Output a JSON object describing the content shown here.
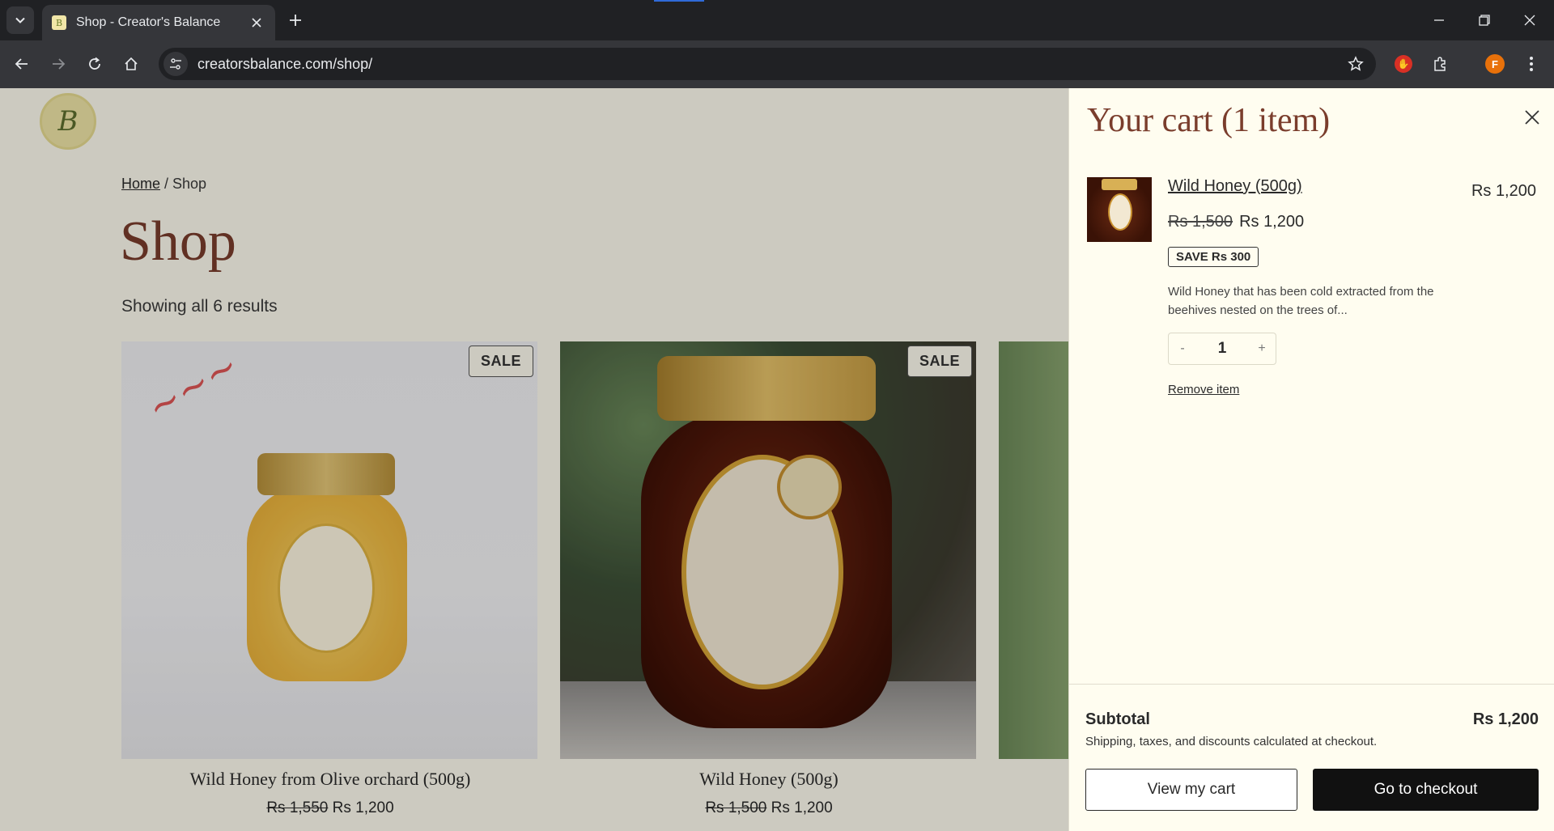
{
  "browser": {
    "tab_title": "Shop - Creator's Balance",
    "url": "creatorsbalance.com/shop/",
    "profile_initial": "F"
  },
  "site": {
    "logo_text": "B"
  },
  "shop": {
    "breadcrumb_home": "Home",
    "breadcrumb_sep": " / ",
    "breadcrumb_current": "Shop",
    "title": "Shop",
    "result_count": "Showing all 6 results",
    "products": [
      {
        "badge": "SALE",
        "name": "Wild Honey from Olive orchard (500g)",
        "old_price": "Rs 1,550",
        "price": "Rs 1,200"
      },
      {
        "badge": "SALE",
        "name": "Wild Honey (500g)",
        "old_price": "Rs 1,500",
        "price": "Rs 1,200"
      }
    ]
  },
  "cart": {
    "title": "Your cart (1 item)",
    "item": {
      "name": "Wild Honey (500g)",
      "line_total": "Rs 1,200",
      "old_price": "Rs 1,500",
      "price": "Rs 1,200",
      "save_badge": "SAVE Rs 300",
      "description": "Wild Honey that has been cold extracted from the beehives nested on the trees of...",
      "qty_minus": "-",
      "quantity": "1",
      "qty_plus": "+",
      "remove_label": "Remove item"
    },
    "subtotal_label": "Subtotal",
    "subtotal_value": "Rs 1,200",
    "subtotal_note": "Shipping, taxes, and discounts calculated at checkout.",
    "view_cart_label": "View my cart",
    "checkout_label": "Go to checkout"
  }
}
